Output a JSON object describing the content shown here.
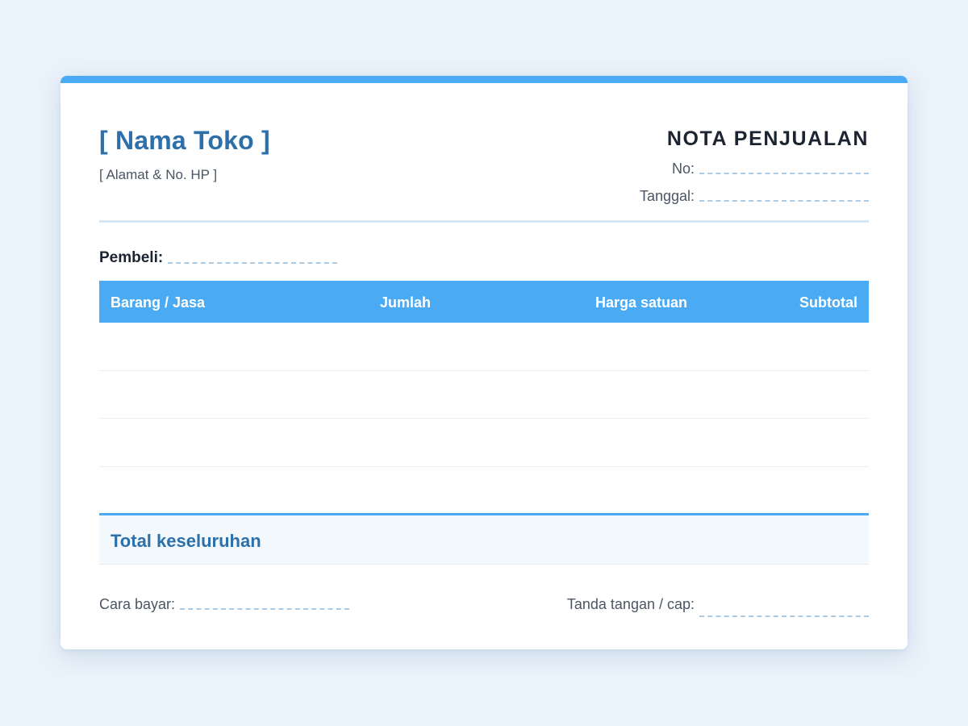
{
  "header": {
    "shop_name": "[ Nama Toko ]",
    "shop_address": "[ Alamat & No. HP ]",
    "doc_title": "NOTA PENJUALAN",
    "no_label": "No:",
    "date_label": "Tanggal:"
  },
  "buyer": {
    "label": "Pembeli:"
  },
  "table": {
    "columns": [
      "Barang / Jasa",
      "Jumlah",
      "Harga satuan",
      "Subtotal"
    ],
    "rows": [
      [
        "",
        "",
        "",
        ""
      ],
      [
        "",
        "",
        "",
        ""
      ],
      [
        "",
        "",
        "",
        ""
      ],
      [
        "",
        "",
        "",
        ""
      ]
    ]
  },
  "total": {
    "label": "Total keseluruhan",
    "value": ""
  },
  "footer": {
    "payment_label": "Cara bayar:",
    "signature_label": "Tanda tangan / cap:"
  },
  "colors": {
    "accent": "#4aabf4",
    "heading_blue": "#2d6fa8",
    "page_background": "#eaf2fa"
  }
}
